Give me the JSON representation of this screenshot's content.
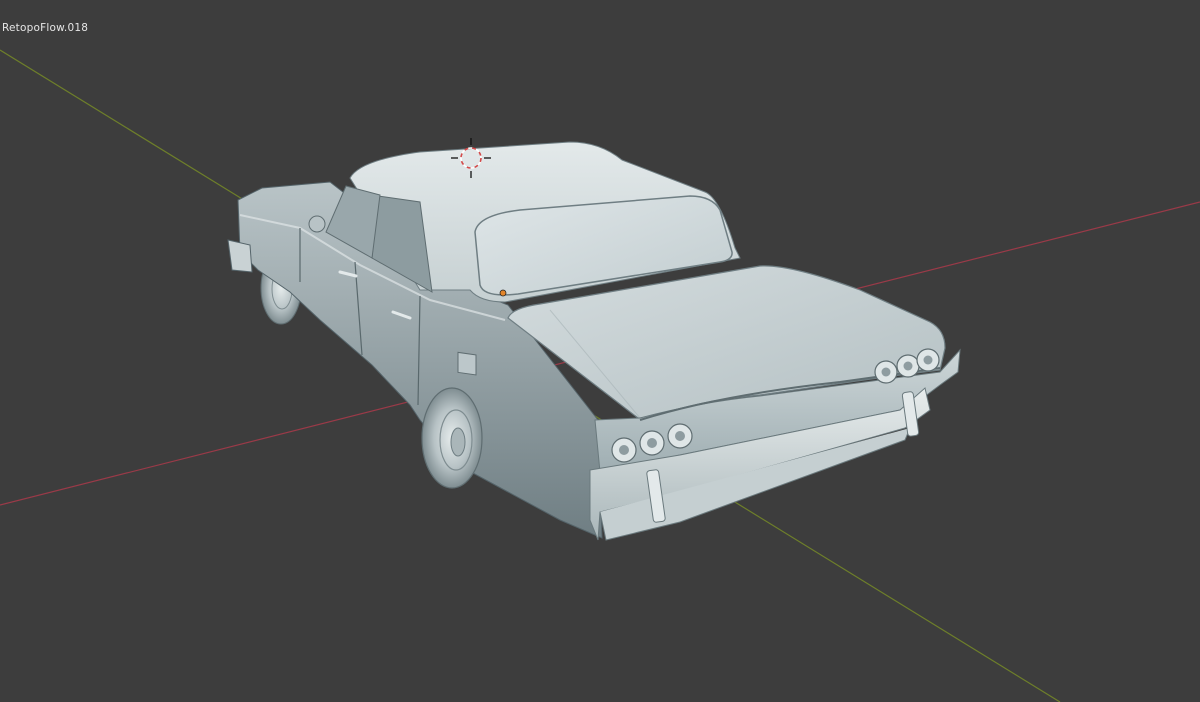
{
  "viewport": {
    "active_object_name": "RetopoFlow.018",
    "background_color": "#3d3d3d",
    "x_axis_color": "#9a3a48",
    "y_axis_color": "#6e7f2a"
  },
  "scene": {
    "model": "car-3d-model",
    "shading": "solid",
    "icons": [
      "3d-cursor-icon",
      "origin-point-icon"
    ]
  }
}
